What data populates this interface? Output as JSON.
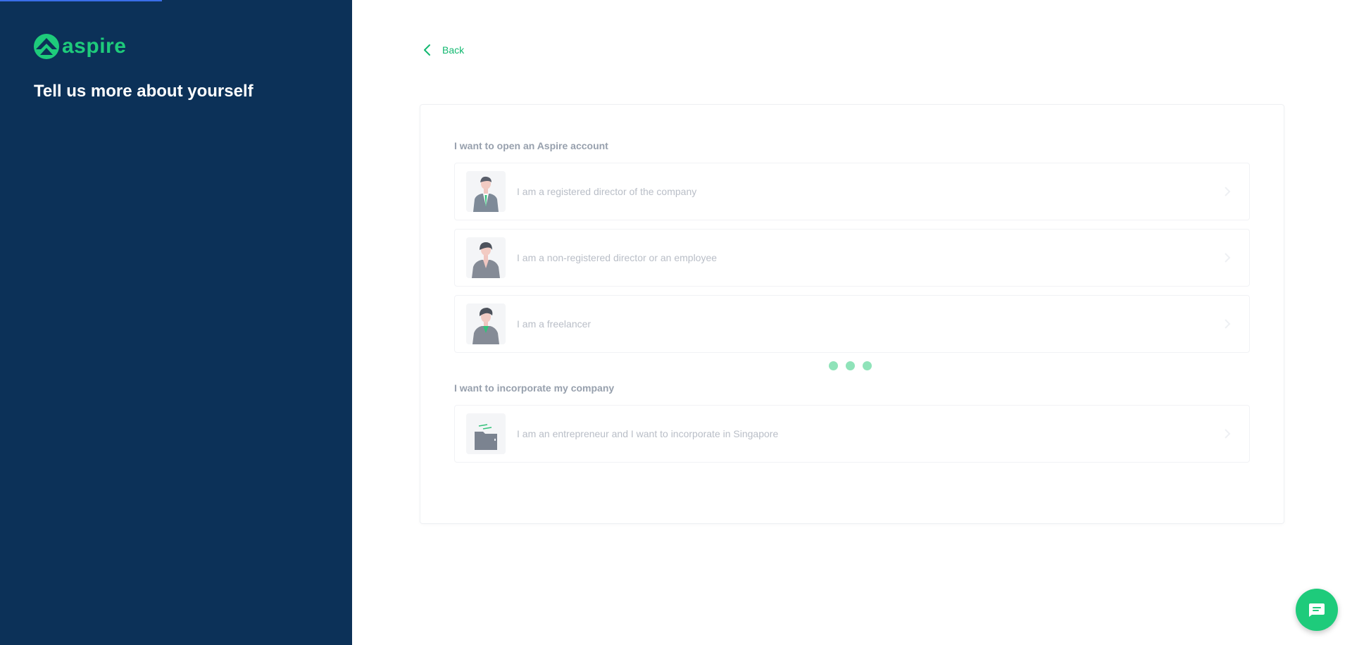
{
  "brand": {
    "name": "aspire",
    "color": "#1ecb7b"
  },
  "sidebar": {
    "title": "Tell us more about yourself",
    "progress_fraction": 0.12
  },
  "nav": {
    "back_label": "Back"
  },
  "sections": [
    {
      "title": "I want to open an Aspire account",
      "options": [
        {
          "label": "I am a registered director of the company",
          "icon": "registered-director-avatar-icon"
        },
        {
          "label": "I am a non-registered director or an employee",
          "icon": "employee-avatar-icon"
        },
        {
          "label": "I am a freelancer",
          "icon": "freelancer-avatar-icon"
        }
      ]
    },
    {
      "title": "I want to incorporate my company",
      "options": [
        {
          "label": "I am an entrepreneur and I want to incorporate in Singapore",
          "icon": "folder-incorporate-icon"
        }
      ]
    }
  ],
  "loading": {
    "dots": 3
  },
  "chat": {
    "icon": "chat-icon"
  },
  "colors": {
    "sidebar_bg": "#0c3158",
    "accent": "#1ecb7b",
    "progress": "#3a6ee8"
  }
}
